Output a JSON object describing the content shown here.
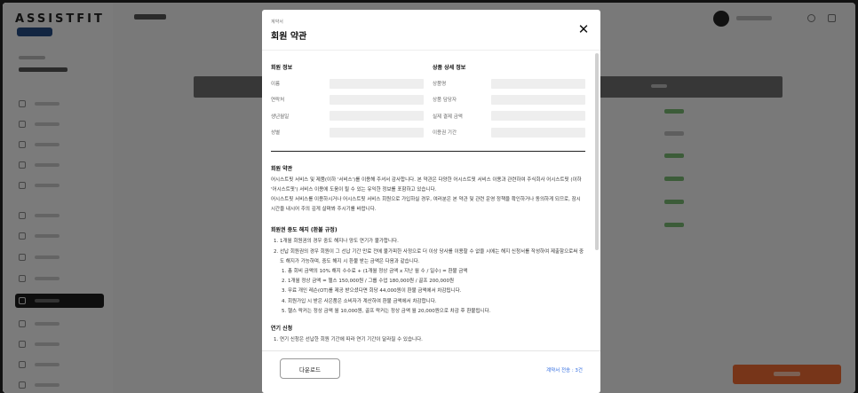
{
  "modal": {
    "breadcrumb": "계약서",
    "title": "회원 약관",
    "member_info": {
      "title": "회원 정보",
      "fields": [
        {
          "label": "이름",
          "value": ""
        },
        {
          "label": "연락처",
          "value": ""
        },
        {
          "label": "생년월일",
          "value": ""
        },
        {
          "label": "성별",
          "value": ""
        }
      ]
    },
    "product_info": {
      "title": "상품 상세 정보",
      "fields": [
        {
          "label": "상품명",
          "value": ""
        },
        {
          "label": "상품 담당자",
          "value": ""
        },
        {
          "label": "실제 결제 금액",
          "value": ""
        },
        {
          "label": "이용권 기간",
          "value": ""
        }
      ]
    },
    "terms": {
      "title": "회원 약관",
      "paragraphs": [
        "어시스트핏 서비스 및 제품(이하 '서비스')를 이용해 주셔서 감사합니다. 본 약관은 다양한 어시스트핏 서비스 이용과 관련하여 주식회사 어시스트핏 (이하 '어시스트핏') 서비스 이용에 도움이 될 수 있는 유익한 정보를 포함하고 있습니다.",
        "어시스트핏 서비스를 이용하시거나 어시스트핏 서비스 회원으로 가입하실 경우, 여러분은 본 약관 및 관련 운영 정책을 확인하거나 동의하게 되므로, 잠시 시간을 내시어 주의 깊게 살펴봐 주시기를 바랍니다."
      ]
    },
    "refund": {
      "title": "회원권 중도 해지 (환불 규정)",
      "rules": [
        "1. 1개월 회원권의 경우 중도 해지나 양도 연기가 불가합니다.",
        "2. 선납 회원권의 경우 회원이 그 선납 기간 만료 전에 불가피한 사정으로 더 이상 당사를 이용할 수 없을 시에는 해지 신청서를 작성하여 제출함으로써 중도 해지가 가능하며, 중도 해지 시 환불 받는 금액은 다음과 같습니다."
      ],
      "sub_rules": [
        "1. 총 회비 금액의 10% 해지 수수료 + (1개월 정상 금액 x 지난 월 수 / 일수) = 환불 금액",
        "2. 1개월 정상 금액 = 헬스 150,000원 / 그룹 수업 180,000원 / 골프 200,000원",
        "3. 무료 개인 레슨(OT)를 제공 받으셨다면 회당 44,000원이 환불 금액에서 차감됩니다.",
        "4. 회원가입 시 받은 사은품은 소비자가 계산하여 환불 금액에서 차감합니다.",
        "5. 헬스 락커는 정상 금액 월 10,000원, 골프 락커는 정상 금액 월 20,000원으로 차감 후 환불됩니다."
      ]
    },
    "postpone": {
      "title": "연기 신청",
      "rules": [
        "1. 연기 신청은 선납한 회원 기간에 따라 연기 기간이 달라질 수 있습니다."
      ]
    },
    "footer": {
      "download_label": "다운로드",
      "send_count": "계약서 전송 : 3건"
    }
  },
  "background": {
    "logo": "ASSISTFIT"
  },
  "colors": {
    "accent_blue": "#2f6be0",
    "cta_orange": "#ee6b33",
    "status_green": "#79b873"
  }
}
